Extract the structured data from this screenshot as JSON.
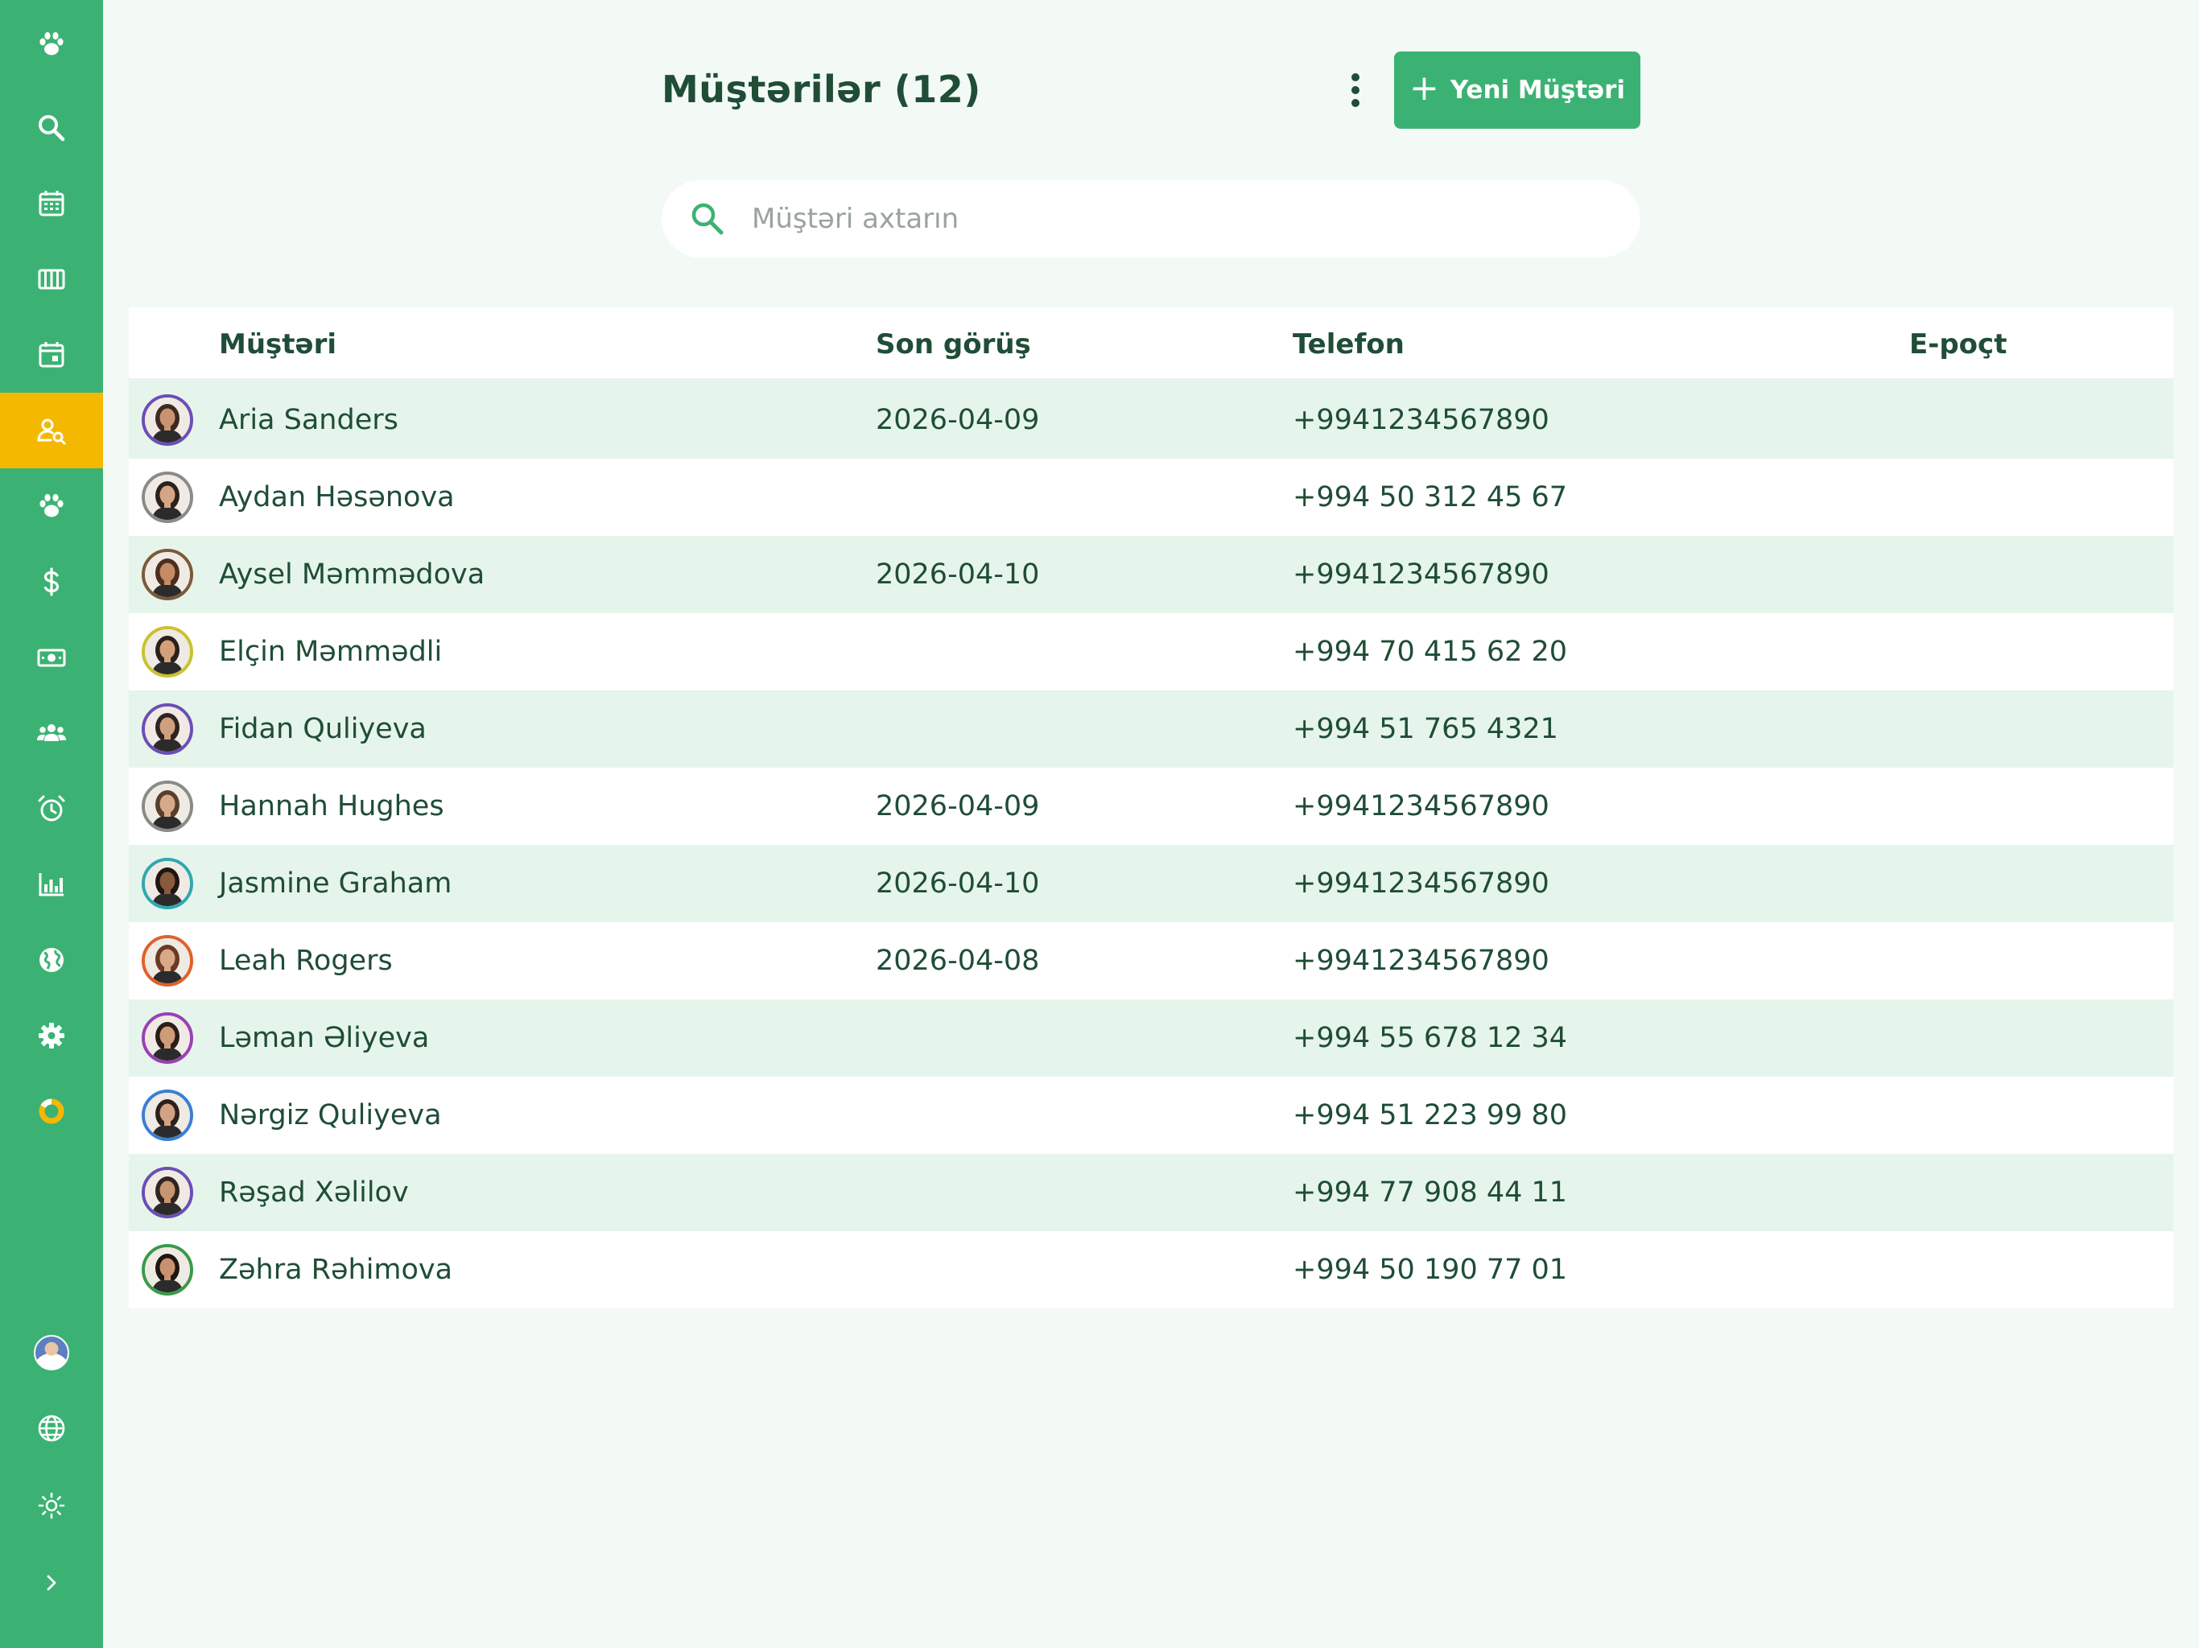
{
  "sidebar": {
    "items": [
      {
        "icon": "paw-logo-icon",
        "active": false
      },
      {
        "icon": "search-icon",
        "active": false
      },
      {
        "icon": "calendar-grid-icon",
        "active": false
      },
      {
        "icon": "columns-icon",
        "active": false
      },
      {
        "icon": "calendar-day-icon",
        "active": false
      },
      {
        "icon": "client-search-icon",
        "active": true
      },
      {
        "icon": "paw-icon",
        "active": false
      },
      {
        "icon": "dollar-icon",
        "active": false
      },
      {
        "icon": "cash-icon",
        "active": false
      },
      {
        "icon": "team-icon",
        "active": false
      },
      {
        "icon": "alarm-icon",
        "active": false
      },
      {
        "icon": "bar-chart-icon",
        "active": false
      },
      {
        "icon": "globe-icon",
        "active": false
      },
      {
        "icon": "gear-icon",
        "active": false
      },
      {
        "icon": "donut-icon",
        "active": false
      }
    ],
    "bottom": [
      "user-avatar",
      "language-globe-icon",
      "sun-icon",
      "chevron-right-icon"
    ],
    "colors": {
      "bg": "#3bb273",
      "active": "#f5b800"
    }
  },
  "header": {
    "title": "Müştərilər (12)",
    "new_button_label": "Yeni Müştəri"
  },
  "search": {
    "placeholder": "Müştəri axtarın",
    "value": ""
  },
  "table": {
    "columns": {
      "client": "Müştəri",
      "last_visit": "Son görüş",
      "phone": "Telefon",
      "email": "E-poçt"
    },
    "rows": [
      {
        "name": "Aria Sanders",
        "last_visit": "2026-04-09",
        "phone": "+9941234567890",
        "email": "",
        "ring": "#6a4fb5",
        "skin": "#c89370",
        "hair": "#3b2a22"
      },
      {
        "name": "Aydan Həsənova",
        "last_visit": "",
        "phone": "+994 50 312 45 67",
        "email": "",
        "ring": "#8a8a8a",
        "skin": "#d6a684",
        "hair": "#2a211c"
      },
      {
        "name": "Aysel Məmmədova",
        "last_visit": "2026-04-10",
        "phone": "+9941234567890",
        "email": "",
        "ring": "#7a5a3a",
        "skin": "#c48b66",
        "hair": "#4a2f20"
      },
      {
        "name": "Elçin Məmmədli",
        "last_visit": "",
        "phone": "+994 70 415 62 20",
        "email": "",
        "ring": "#c9c230",
        "skin": "#d3a079",
        "hair": "#2a211c"
      },
      {
        "name": "Fidan Quliyeva",
        "last_visit": "",
        "phone": "+994 51 765 4321",
        "email": "",
        "ring": "#6a4fb5",
        "skin": "#d0a07e",
        "hair": "#2f2320"
      },
      {
        "name": "Hannah Hughes",
        "last_visit": "2026-04-09",
        "phone": "+9941234567890",
        "email": "",
        "ring": "#8a8a8a",
        "skin": "#d6a98a",
        "hair": "#5a3d2c"
      },
      {
        "name": "Jasmine Graham",
        "last_visit": "2026-04-10",
        "phone": "+9941234567890",
        "email": "",
        "ring": "#2fa8b0",
        "skin": "#8a5a3c",
        "hair": "#1e1612"
      },
      {
        "name": "Leah Rogers",
        "last_visit": "2026-04-08",
        "phone": "+9941234567890",
        "email": "",
        "ring": "#e0602a",
        "skin": "#d8a888",
        "hair": "#6b3a22"
      },
      {
        "name": "Ləman Əliyeva",
        "last_visit": "",
        "phone": "+994 55 678 12 34",
        "email": "",
        "ring": "#9b3fb5",
        "skin": "#cf9c78",
        "hair": "#2a1d18"
      },
      {
        "name": "Nərgiz Quliyeva",
        "last_visit": "",
        "phone": "+994 51 223 99 80",
        "email": "",
        "ring": "#3a7fd0",
        "skin": "#d3a282",
        "hair": "#2b201b"
      },
      {
        "name": "Rəşad Xəlilov",
        "last_visit": "",
        "phone": "+994 77 908 44 11",
        "email": "",
        "ring": "#6a4fb5",
        "skin": "#c99472",
        "hair": "#2f2420"
      },
      {
        "name": "Zəhra Rəhimova",
        "last_visit": "",
        "phone": "+994 50 190 77 01",
        "email": "",
        "ring": "#3a9a4a",
        "skin": "#c89270",
        "hair": "#1e1612"
      }
    ]
  }
}
